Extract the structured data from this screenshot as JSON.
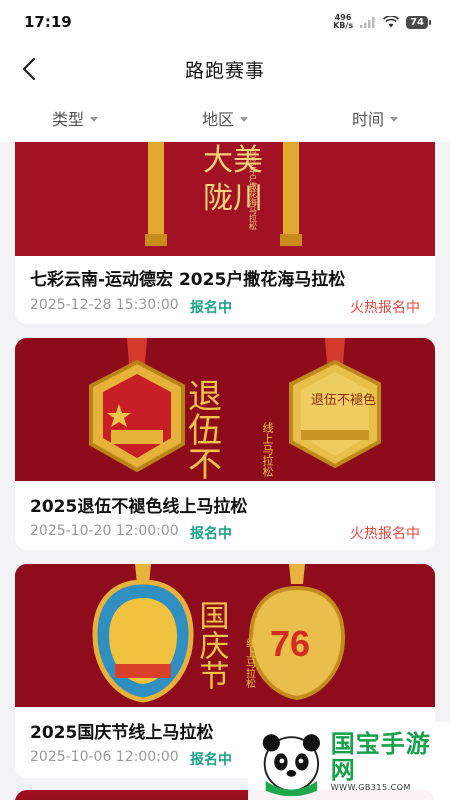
{
  "status_bar": {
    "time": "17:19",
    "net_speed_value": "496",
    "net_speed_unit": "KB/s",
    "battery": "74"
  },
  "nav": {
    "title": "路跑赛事"
  },
  "filters": [
    {
      "label": "类型"
    },
    {
      "label": "地区"
    },
    {
      "label": "时间"
    }
  ],
  "events": [
    {
      "title": "七彩云南-运动德宏 2025户撒花海马拉松",
      "datetime": "2025-12-28 15:30:00",
      "status": "报名中",
      "hot_label": "火热报名中",
      "banner_text": "大美陇川",
      "banner_subtext": "2025年户撒花海马拉松"
    },
    {
      "title": "2025退伍不褪色线上马拉松",
      "datetime": "2025-10-20 12:00:00",
      "status": "报名中",
      "hot_label": "火热报名中",
      "banner_text": "退伍不褪色",
      "banner_subtext": "线上马拉松",
      "medal_text": "退伍不褪色"
    },
    {
      "title": "2025国庆节线上马拉松",
      "datetime": "2025-10-06 12:00:00",
      "status": "报名中",
      "banner_text": "国庆节",
      "banner_subtext": "线上马拉松",
      "medal_text": "76"
    }
  ],
  "watermark": {
    "name": "国宝手游网",
    "url": "WWW.GB315.COM"
  },
  "colors": {
    "status_green": "#1aa389",
    "hot_red": "#e8483f",
    "banner_red": "#9c0f20",
    "gold": "#e9b83a"
  }
}
